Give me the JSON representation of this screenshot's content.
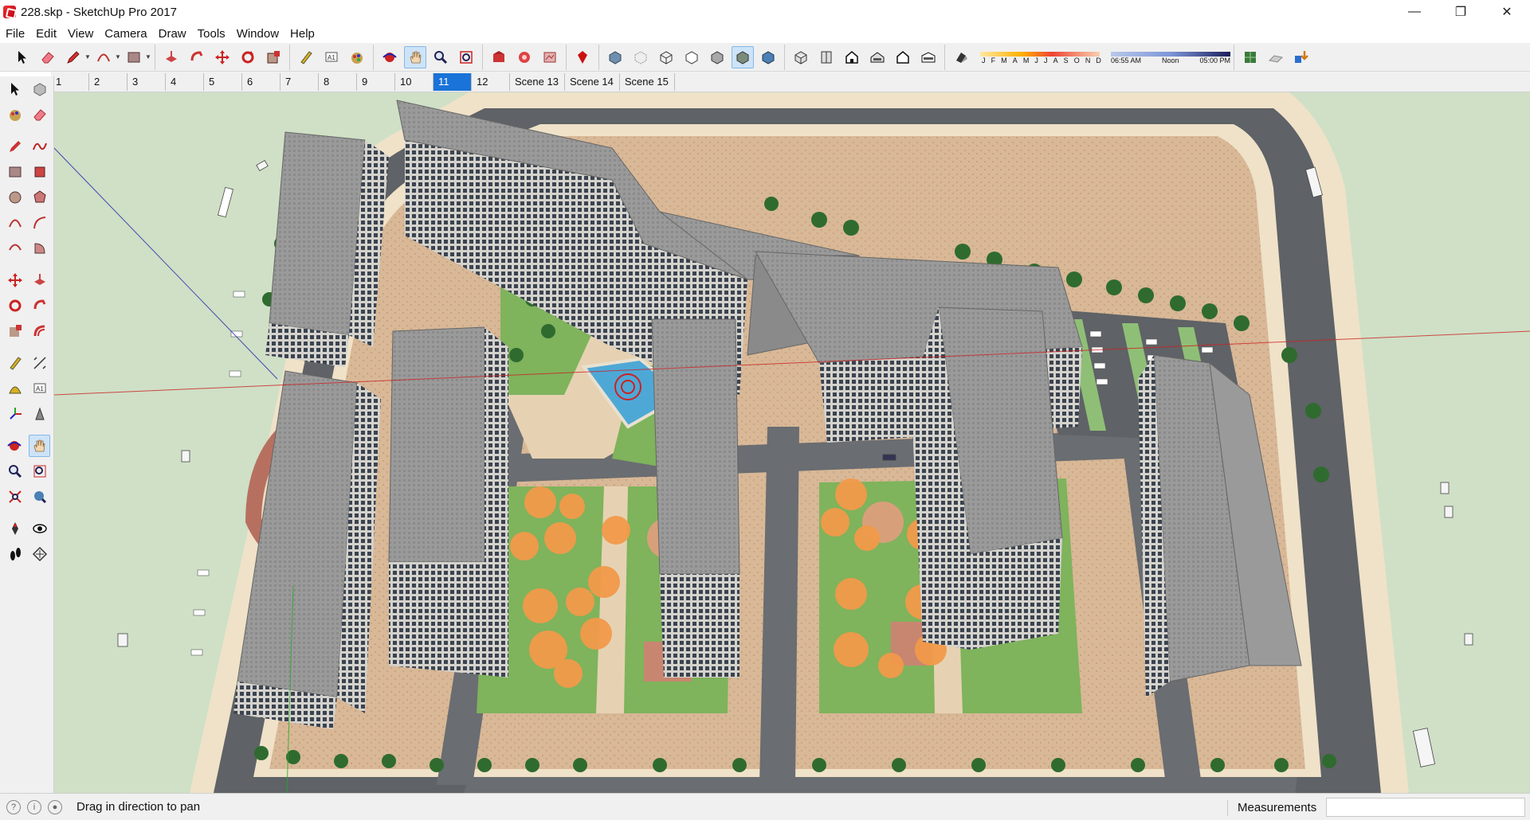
{
  "window": {
    "title": "228.skp - SketchUp Pro 2017",
    "controls": {
      "minimize": "—",
      "maximize": "❐",
      "close": "✕"
    }
  },
  "menu": [
    "File",
    "Edit",
    "View",
    "Camera",
    "Draw",
    "Tools",
    "Window",
    "Help"
  ],
  "toolbar": {
    "icons": [
      "select-icon",
      "eraser-icon",
      "pencil-icon",
      "arc-icon",
      "rectangle-icon",
      "push-pull-icon",
      "follow-me-icon",
      "move-icon",
      "rotate-icon",
      "scale-icon",
      "tape-measure-icon",
      "text-icon",
      "paint-bucket-icon",
      "orbit-icon",
      "pan-icon",
      "zoom-icon",
      "zoom-extents-icon",
      "warehouse-icon",
      "extension-warehouse-icon",
      "layout-icon",
      "ruby-icon",
      "xray-icon",
      "back-edges-icon",
      "wireframe-icon",
      "hidden-line-icon",
      "shaded-icon",
      "shaded-texture-icon",
      "monochrome-icon",
      "iso-view-icon",
      "top-view-icon",
      "front-view-icon",
      "right-view-icon",
      "back-view-icon",
      "left-view-icon",
      "shadows-icon"
    ],
    "shadow_months": [
      "J",
      "F",
      "M",
      "A",
      "M",
      "J",
      "J",
      "A",
      "S",
      "O",
      "N",
      "D"
    ],
    "shadow_times": [
      "06:55 AM",
      "Noon",
      "05:00 PM"
    ]
  },
  "scenes": [
    {
      "label": "1",
      "active": false
    },
    {
      "label": "2",
      "active": false
    },
    {
      "label": "3",
      "active": false
    },
    {
      "label": "4",
      "active": false
    },
    {
      "label": "5",
      "active": false
    },
    {
      "label": "6",
      "active": false
    },
    {
      "label": "7",
      "active": false
    },
    {
      "label": "8",
      "active": false
    },
    {
      "label": "9",
      "active": false
    },
    {
      "label": "10",
      "active": false
    },
    {
      "label": "11",
      "active": true
    },
    {
      "label": "12",
      "active": false
    },
    {
      "label": "Scene 13",
      "active": false
    },
    {
      "label": "Scene 14",
      "active": false
    },
    {
      "label": "Scene 15",
      "active": false
    }
  ],
  "status": {
    "hint": "Drag in direction to pan",
    "measurements_label": "Measurements",
    "measurements_value": ""
  },
  "colors": {
    "grass": "#cfe0c6",
    "road": "#5f6266",
    "sidewalk": "#efe2c8",
    "plaza": "#d8b897",
    "roof": "#8d8d8d",
    "facade": "#6f7377",
    "tree": "#2f6b2f",
    "autumn_tree": "#f29a4a",
    "pool": "#4ea8d6",
    "active_tab": "#1a73d8"
  }
}
